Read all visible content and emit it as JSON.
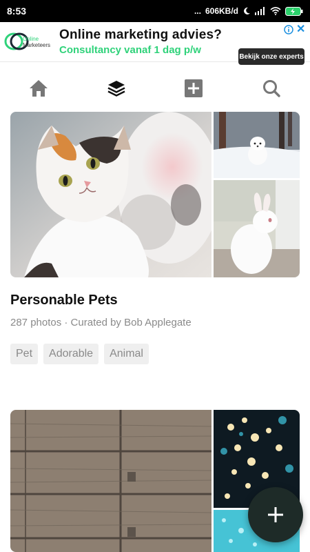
{
  "status_bar": {
    "time": "8:53",
    "dots": "...",
    "network_speed": "606KB/d"
  },
  "ad": {
    "brand_line1": "Online",
    "brand_line2": "Marketeers",
    "headline": "Online marketing advies?",
    "subline": "Consultancy vanaf 1 dag p/w",
    "cta": "Bekijk onze experts",
    "close": "✕"
  },
  "nav": {
    "items": [
      {
        "icon": "home-icon"
      },
      {
        "icon": "collections-icon",
        "active": true
      },
      {
        "icon": "add-photo-icon"
      },
      {
        "icon": "search-icon"
      }
    ]
  },
  "collections": [
    {
      "title": "Personable Pets",
      "meta": "287 photos · Curated by Bob Applegate",
      "tags": [
        "Pet",
        "Adorable",
        "Animal"
      ],
      "images": [
        "kitten-photo",
        "white-dog-in-snow-photo",
        "white-rabbit-photo"
      ]
    },
    {
      "title": "",
      "images": [
        "wooden-planks-photo",
        "bokeh-lights-photo",
        "blue-glitter-photo"
      ]
    }
  ],
  "colors": {
    "ad_accent": "#2fd27a",
    "fab": "#1e2b28",
    "tag_bg": "#efefef",
    "nav_icon": "#666666"
  },
  "fab": {
    "icon": "plus-icon"
  }
}
